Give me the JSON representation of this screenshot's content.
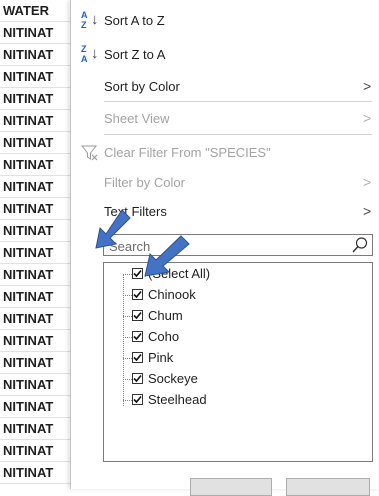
{
  "sheet": {
    "header": "WATER",
    "cells": [
      "NITINAT",
      "NITINAT",
      "NITINAT",
      "NITINAT",
      "NITINAT",
      "NITINAT",
      "NITINAT",
      "NITINAT",
      "NITINAT",
      "NITINAT",
      "NITINAT",
      "NITINAT",
      "NITINAT",
      "NITINAT",
      "NITINAT",
      "NITINAT",
      "NITINAT",
      "NITINAT",
      "NITINAT",
      "NITINAT",
      "NITINAT"
    ]
  },
  "menu": {
    "sort_az": "Sort A to Z",
    "sort_za": "Sort Z to A",
    "sort_by_color": "Sort by Color",
    "sheet_view": "Sheet View",
    "clear_filter": "Clear Filter From \"SPECIES\"",
    "filter_by_color": "Filter by Color",
    "text_filters": "Text Filters",
    "search_placeholder": "Search",
    "items": [
      {
        "label": "(Select All)",
        "checked": true
      },
      {
        "label": "Chinook",
        "checked": true
      },
      {
        "label": "Chum",
        "checked": true
      },
      {
        "label": "Coho",
        "checked": true
      },
      {
        "label": "Pink",
        "checked": true
      },
      {
        "label": "Sockeye",
        "checked": true
      },
      {
        "label": "Steelhead",
        "checked": true
      }
    ]
  },
  "colors": {
    "annotation_arrow": "#4472c4"
  }
}
